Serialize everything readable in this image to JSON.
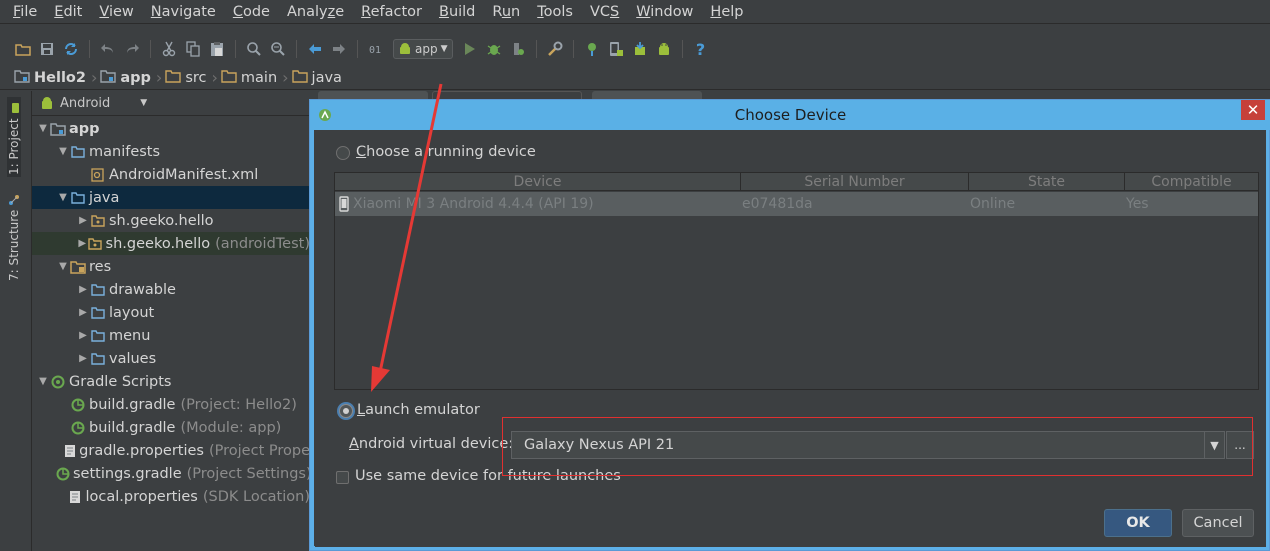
{
  "menu": {
    "items": [
      {
        "pre": "",
        "key": "F",
        "post": "ile"
      },
      {
        "pre": "",
        "key": "E",
        "post": "dit"
      },
      {
        "pre": "",
        "key": "V",
        "post": "iew"
      },
      {
        "pre": "",
        "key": "N",
        "post": "avigate"
      },
      {
        "pre": "",
        "key": "C",
        "post": "ode"
      },
      {
        "pre": "Analy",
        "key": "z",
        "post": "e"
      },
      {
        "pre": "",
        "key": "R",
        "post": "efactor"
      },
      {
        "pre": "",
        "key": "B",
        "post": "uild"
      },
      {
        "pre": "R",
        "key": "u",
        "post": "n"
      },
      {
        "pre": "",
        "key": "T",
        "post": "ools"
      },
      {
        "pre": "VC",
        "key": "S",
        "post": ""
      },
      {
        "pre": "",
        "key": "W",
        "post": "indow"
      },
      {
        "pre": "",
        "key": "H",
        "post": "elp"
      }
    ]
  },
  "toolbar": {
    "run_config": "app"
  },
  "breadcrumb": [
    "Hello2",
    "app",
    "src",
    "main",
    "java"
  ],
  "sidebar": {
    "project_tab": "1: Project",
    "structure_tab": "7: Structure"
  },
  "project_panel": {
    "view_mode": "Android",
    "tree": [
      {
        "label": "app",
        "extra": "",
        "depth": 0,
        "arrow": "down",
        "icon": "module-icon",
        "bold": true
      },
      {
        "label": "manifests",
        "extra": "",
        "depth": 1,
        "arrow": "down",
        "icon": "folder-icon"
      },
      {
        "label": "AndroidManifest.xml",
        "extra": "",
        "depth": 2,
        "arrow": "",
        "icon": "manifest-file-icon"
      },
      {
        "label": "java",
        "extra": "",
        "depth": 1,
        "arrow": "down",
        "icon": "folder-icon",
        "selected": true
      },
      {
        "label": "sh.geeko.hello",
        "extra": "",
        "depth": 2,
        "arrow": "right",
        "icon": "package-icon"
      },
      {
        "label": "sh.geeko.hello",
        "extra": "(androidTest)",
        "depth": 2,
        "arrow": "right",
        "icon": "package-icon",
        "selected_light": true
      },
      {
        "label": "res",
        "extra": "",
        "depth": 1,
        "arrow": "down",
        "icon": "res-folder-icon"
      },
      {
        "label": "drawable",
        "extra": "",
        "depth": 2,
        "arrow": "right",
        "icon": "folder-icon"
      },
      {
        "label": "layout",
        "extra": "",
        "depth": 2,
        "arrow": "right",
        "icon": "folder-icon"
      },
      {
        "label": "menu",
        "extra": "",
        "depth": 2,
        "arrow": "right",
        "icon": "folder-icon"
      },
      {
        "label": "values",
        "extra": "",
        "depth": 2,
        "arrow": "right",
        "icon": "folder-icon"
      },
      {
        "label": "Gradle Scripts",
        "extra": "",
        "depth": 0,
        "arrow": "down",
        "icon": "gradle-icon"
      },
      {
        "label": "build.gradle",
        "extra": "(Project: Hello2)",
        "depth": 1,
        "arrow": "",
        "icon": "gradle-file-icon"
      },
      {
        "label": "build.gradle",
        "extra": "(Module: app)",
        "depth": 1,
        "arrow": "",
        "icon": "gradle-file-icon"
      },
      {
        "label": "gradle.properties",
        "extra": "(Project Prope",
        "depth": 1,
        "arrow": "",
        "icon": "properties-file-icon"
      },
      {
        "label": "settings.gradle",
        "extra": "(Project Settings)",
        "depth": 1,
        "arrow": "",
        "icon": "gradle-file-icon"
      },
      {
        "label": "local.properties",
        "extra": "(SDK Location)",
        "depth": 1,
        "arrow": "",
        "icon": "properties-file-icon"
      }
    ]
  },
  "dialog": {
    "title": "Choose Device",
    "close_glyph": "✕",
    "choose_running": "Choose a running device",
    "choose_running_key": "C",
    "table": {
      "columns": [
        "Device",
        "Serial Number",
        "State",
        "Compatible"
      ],
      "rows": [
        {
          "device": "Xiaomi MI 3 Android 4.4.4 (API 19)",
          "serial": "e07481da",
          "state": "Online",
          "compatible": "Yes"
        }
      ]
    },
    "launch_emulator": "Launch emulator",
    "launch_emulator_key": "L",
    "avd_label": "Android virtual device:",
    "avd_label_key": "A",
    "avd_value": "Galaxy Nexus API 21",
    "avd_more": "...",
    "same_device": "Use same device for future launches",
    "ok": "OK",
    "cancel": "Cancel"
  },
  "colors": {
    "ide_background": "#3c3f41",
    "dialog_title_bar": "#5ab0e6",
    "selection": "#0d293e",
    "annotation_red": "#e03030",
    "ok_button": "#365880"
  }
}
